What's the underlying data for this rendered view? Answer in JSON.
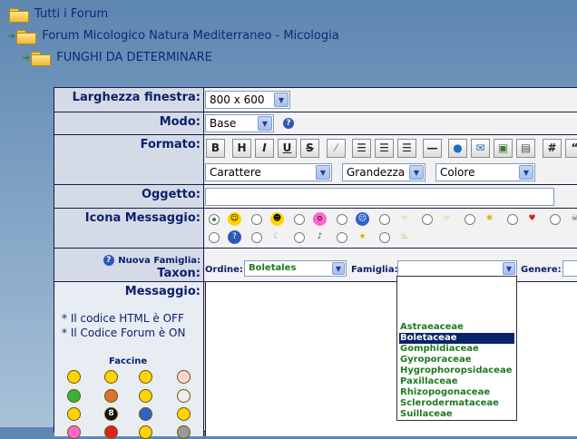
{
  "breadcrumbs": [
    {
      "label": "Tutti i Forum"
    },
    {
      "label": "Forum Micologico Natura Mediterraneo - Micologia"
    },
    {
      "label": "FUNGHI DA DETERMINARE"
    }
  ],
  "form": {
    "window_width_label": "Larghezza finestra:",
    "window_width_value": "800 x 600",
    "mode_label": "Modo:",
    "mode_value": "Base",
    "format_label": "Formato:",
    "toolbar": [
      "B",
      "H",
      "I",
      "U",
      "S"
    ],
    "font_value": "Carattere",
    "size_value": "Grandezza",
    "color_value": "Colore",
    "subject_label": "Oggetto:",
    "subject_value": "",
    "icon_label": "Icona Messaggio:",
    "family_new_label": "Nuova Famiglia:",
    "taxon_label": "Taxon:",
    "order_label": "Ordine:",
    "order_value": "Boletales",
    "family_label": "Famiglia:",
    "family_value": "",
    "genus_label": "Genere:",
    "message_label": "Messaggio:",
    "html_note": "* Il codice HTML è OFF",
    "forum_code_note": "* Il Codice Forum è ON",
    "faces_label": "Faccine"
  },
  "family_options": [
    "Astraeaceae",
    "Boletaceae",
    "Gomphidiaceae",
    "Gyroporaceae",
    "Hygrophoropsidaceae",
    "Paxillaceae",
    "Rhizopogonaceae",
    "Sclerodermataceae",
    "Suillaceae"
  ],
  "selected_family": "Boletaceae",
  "colors": {
    "label_blue": "#0b1f6b",
    "option_green": "#1f7a1f",
    "selection": "#0a246a"
  }
}
